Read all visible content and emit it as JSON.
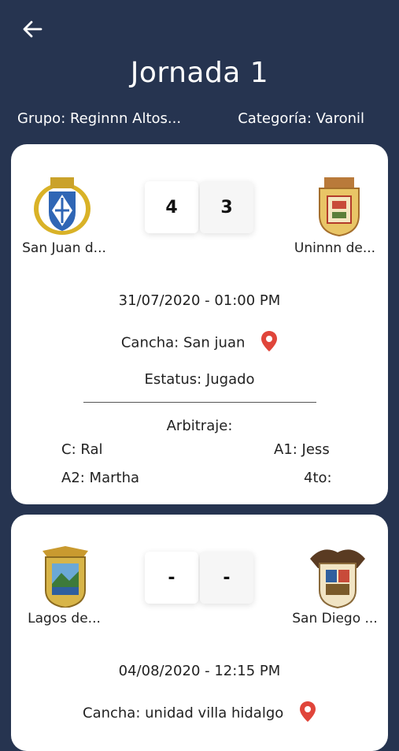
{
  "header": {
    "back_icon": "arrow-left-icon",
    "title": "Jornada 1",
    "group": "Grupo: Reginnn Altos...",
    "category": "Categoría: Varonil"
  },
  "matches": [
    {
      "home": {
        "name": "San Juan d...",
        "crest_icon": "shield-crest-blue-icon"
      },
      "away": {
        "name": "Uninnn de...",
        "crest_icon": "shield-crest-gold-icon"
      },
      "home_score": "4",
      "away_score": "3",
      "datetime": "31/07/2020 - 01:00 PM",
      "venue": "Cancha: San juan",
      "status": "Estatus: Jugado",
      "referees_title": "Arbitraje:",
      "ref_c": "C: Ral",
      "ref_a1": "A1: Jess",
      "ref_a2": "A2: Martha",
      "ref_4to": "4to:"
    },
    {
      "home": {
        "name": "Lagos de...",
        "crest_icon": "shield-crest-lagos-icon"
      },
      "away": {
        "name": "San Diego ...",
        "crest_icon": "eagle-crest-icon"
      },
      "home_score": "-",
      "away_score": "-",
      "datetime": "04/08/2020 - 12:15 PM",
      "venue": "Cancha: unidad villa hidalgo"
    }
  ],
  "colors": {
    "background": "#263450",
    "card": "#ffffff",
    "pin": "#e0453a"
  }
}
